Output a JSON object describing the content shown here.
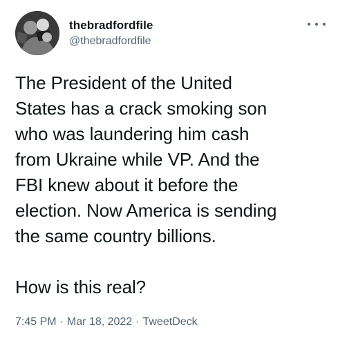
{
  "tweet": {
    "display_name": "thebradfordfile",
    "handle": "@thebradfordfile",
    "text": "The President of the United\nStates has a crack smoking son\nwho was laundering him cash\nfrom Ukraine while VP. And the\nFBI knew about it  before the\nelection. Now America is sending\nthe same country billions.\n\nHow is this real?",
    "time": "7:45 PM",
    "date": "Mar 18, 2022",
    "source": "TweetDeck",
    "separator": "·"
  },
  "icons": {
    "avatar": "profile-avatar",
    "more": "more-options-icon"
  },
  "colors": {
    "text_primary": "#0f1419",
    "text_secondary": "#536471",
    "background": "#ffffff"
  }
}
